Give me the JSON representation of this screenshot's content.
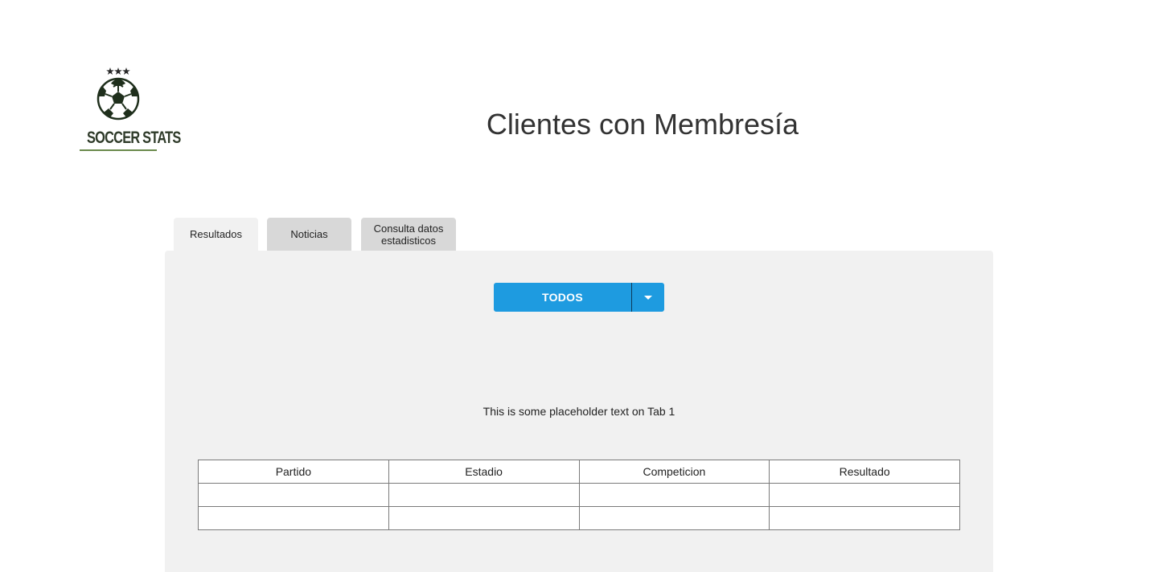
{
  "logo": {
    "text": "SOCCER STATS"
  },
  "header": {
    "title": "Clientes con Membresía"
  },
  "tabs": [
    {
      "label": "Resultados",
      "active": true
    },
    {
      "label": "Noticias",
      "active": false
    },
    {
      "label": "Consulta datos estadisticos",
      "active": false
    }
  ],
  "filter": {
    "selected": "TODOS",
    "toggle_icon": "caret-down-icon"
  },
  "content": {
    "placeholder": "This is some placeholder text on Tab 1"
  },
  "table": {
    "columns": [
      "Partido",
      "Estadio",
      "Competicion",
      "Resultado"
    ],
    "rows": [
      [
        "",
        "",
        "",
        ""
      ],
      [
        "",
        "",
        "",
        ""
      ]
    ]
  },
  "colors": {
    "accent": "#1e9be0",
    "panel": "#f1f1f1",
    "tab_inactive": "#d8d8d8",
    "logo_green": "#2f3b2a"
  }
}
